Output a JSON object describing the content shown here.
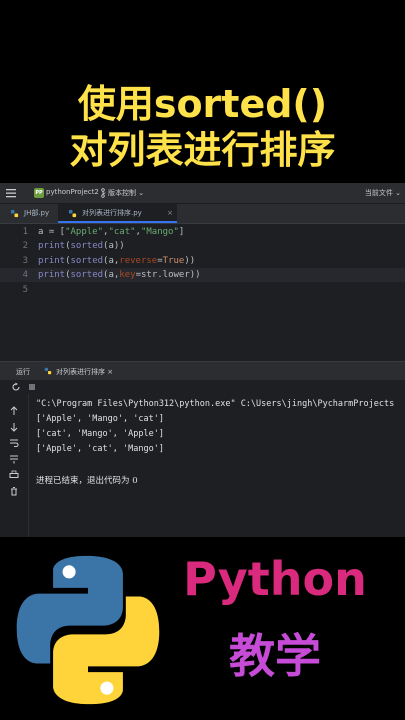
{
  "headline": {
    "line1": "使用sorted()",
    "line2": "对列表进行排序"
  },
  "ide": {
    "titlebar": {
      "project_badge": "PP",
      "project_name": "pythonProject2 ⌄",
      "vcs_label": "版本控制 ⌄",
      "current_file": "当前文件 ⌄"
    },
    "tabs": [
      {
        "label": "JH部.py",
        "active": false
      },
      {
        "label": "对列表进行排序.py",
        "active": true,
        "close": "×"
      }
    ],
    "editor": {
      "line_numbers": [
        "1",
        "2",
        "3",
        "4",
        "5"
      ],
      "lines": [
        [
          {
            "t": "a = [",
            "c": "#bcbec4"
          },
          {
            "t": "\"Apple\"",
            "c": "#6aab73"
          },
          {
            "t": ",",
            "c": "#bcbec4"
          },
          {
            "t": "\"cat\"",
            "c": "#6aab73"
          },
          {
            "t": ",",
            "c": "#bcbec4"
          },
          {
            "t": "\"Mango\"",
            "c": "#6aab73"
          },
          {
            "t": "]",
            "c": "#bcbec4"
          }
        ],
        [
          {
            "t": "print",
            "c": "#8888c6"
          },
          {
            "t": "(",
            "c": "#bcbec4"
          },
          {
            "t": "sorted",
            "c": "#8888c6"
          },
          {
            "t": "(a))",
            "c": "#bcbec4"
          }
        ],
        [
          {
            "t": "print",
            "c": "#8888c6"
          },
          {
            "t": "(",
            "c": "#bcbec4"
          },
          {
            "t": "sorted",
            "c": "#8888c6"
          },
          {
            "t": "(a,",
            "c": "#bcbec4"
          },
          {
            "t": "reverse",
            "c": "#aa4926"
          },
          {
            "t": "=",
            "c": "#bcbec4"
          },
          {
            "t": "True",
            "c": "#cf8e6d"
          },
          {
            "t": "))",
            "c": "#bcbec4"
          }
        ],
        [
          {
            "t": "print",
            "c": "#8888c6"
          },
          {
            "t": "(",
            "c": "#bcbec4"
          },
          {
            "t": "sorted",
            "c": "#8888c6"
          },
          {
            "t": "(a,",
            "c": "#bcbec4"
          },
          {
            "t": "key",
            "c": "#aa4926"
          },
          {
            "t": "=str.lower))",
            "c": "#bcbec4"
          }
        ],
        []
      ]
    },
    "run_panel": {
      "label": "运行",
      "tab": "对列表进行排序 ×",
      "console": [
        "\"C:\\Program Files\\Python312\\python.exe\" C:\\Users\\jingh\\PycharmProjects",
        "['Apple', 'Mango', 'cat']",
        "['cat', 'Mango', 'Apple']",
        "['Apple', 'cat', 'Mango']",
        "",
        "进程已结束，退出代码为 0"
      ]
    }
  },
  "brand": {
    "line1": "Python",
    "line2": "教学"
  },
  "colors": {
    "headline": "#ffe14a",
    "python_logo_blue": "#3b75a7",
    "python_logo_yellow": "#ffd43b",
    "brand_python": "#d92a7e",
    "brand_teach": "#c64bd6",
    "accent": "#3574f0"
  },
  "icons": [
    "hamburger-menu-icon",
    "python-file-icon",
    "rerun-icon",
    "stop-icon",
    "python-logo"
  ]
}
